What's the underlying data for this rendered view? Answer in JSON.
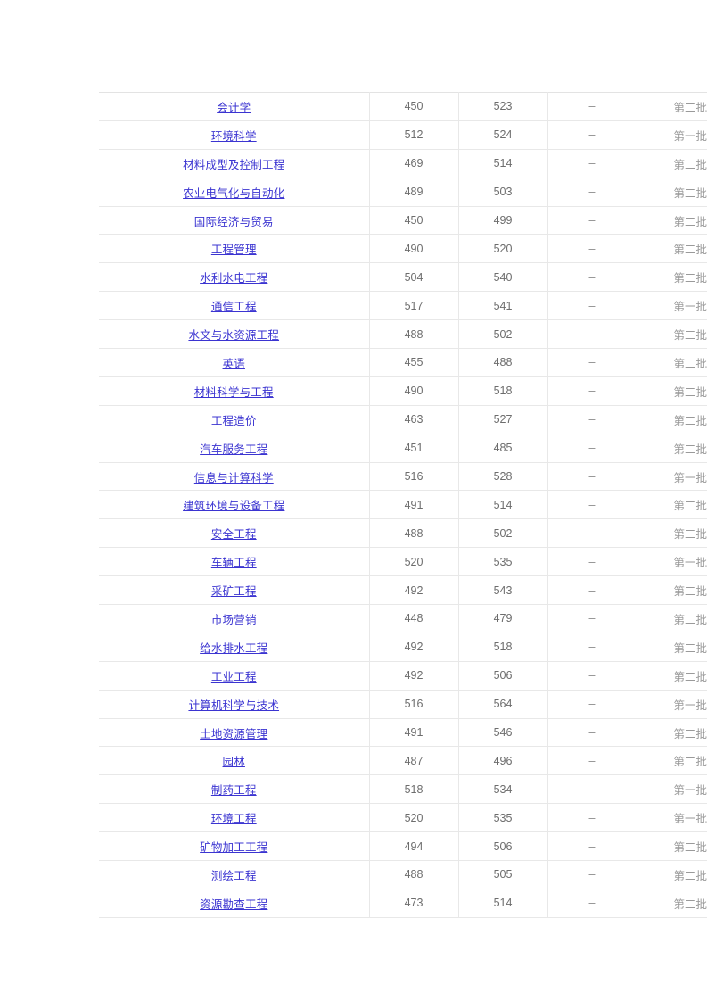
{
  "table": {
    "columns": [
      {
        "key": "major",
        "name": "major-name"
      },
      {
        "key": "min",
        "name": "min-score"
      },
      {
        "key": "avg",
        "name": "avg-score"
      },
      {
        "key": "rank",
        "name": "rank-value"
      },
      {
        "key": "batch",
        "name": "admission-batch"
      }
    ],
    "link_color": "#3b34d1",
    "major_cell_bg": "#f1f1f1",
    "grid_color": "#e8e8e8",
    "rows": [
      {
        "major": "会计学",
        "min": "450",
        "avg": "523",
        "rank": "–",
        "batch": "第二批"
      },
      {
        "major": "环境科学",
        "min": "512",
        "avg": "524",
        "rank": "–",
        "batch": "第一批"
      },
      {
        "major": "材料成型及控制工程",
        "min": "469",
        "avg": "514",
        "rank": "–",
        "batch": "第二批"
      },
      {
        "major": "农业电气化与自动化",
        "min": "489",
        "avg": "503",
        "rank": "–",
        "batch": "第二批"
      },
      {
        "major": "国际经济与贸易",
        "min": "450",
        "avg": "499",
        "rank": "–",
        "batch": "第二批"
      },
      {
        "major": "工程管理",
        "min": "490",
        "avg": "520",
        "rank": "–",
        "batch": "第二批"
      },
      {
        "major": "水利水电工程",
        "min": "504",
        "avg": "540",
        "rank": "–",
        "batch": "第二批"
      },
      {
        "major": "通信工程",
        "min": "517",
        "avg": "541",
        "rank": "–",
        "batch": "第一批"
      },
      {
        "major": "水文与水资源工程",
        "min": "488",
        "avg": "502",
        "rank": "–",
        "batch": "第二批"
      },
      {
        "major": "英语",
        "min": "455",
        "avg": "488",
        "rank": "–",
        "batch": "第二批"
      },
      {
        "major": "材料科学与工程",
        "min": "490",
        "avg": "518",
        "rank": "–",
        "batch": "第二批"
      },
      {
        "major": "工程造价",
        "min": "463",
        "avg": "527",
        "rank": "–",
        "batch": "第二批"
      },
      {
        "major": "汽车服务工程",
        "min": "451",
        "avg": "485",
        "rank": "–",
        "batch": "第二批"
      },
      {
        "major": "信息与计算科学",
        "min": "516",
        "avg": "528",
        "rank": "–",
        "batch": "第一批"
      },
      {
        "major": "建筑环境与设备工程",
        "min": "491",
        "avg": "514",
        "rank": "–",
        "batch": "第二批"
      },
      {
        "major": "安全工程",
        "min": "488",
        "avg": "502",
        "rank": "–",
        "batch": "第二批"
      },
      {
        "major": "车辆工程",
        "min": "520",
        "avg": "535",
        "rank": "–",
        "batch": "第一批"
      },
      {
        "major": "采矿工程",
        "min": "492",
        "avg": "543",
        "rank": "–",
        "batch": "第二批"
      },
      {
        "major": "市场营销",
        "min": "448",
        "avg": "479",
        "rank": "–",
        "batch": "第二批"
      },
      {
        "major": "给水排水工程",
        "min": "492",
        "avg": "518",
        "rank": "–",
        "batch": "第二批"
      },
      {
        "major": "工业工程",
        "min": "492",
        "avg": "506",
        "rank": "–",
        "batch": "第二批"
      },
      {
        "major": "计算机科学与技术",
        "min": "516",
        "avg": "564",
        "rank": "–",
        "batch": "第一批"
      },
      {
        "major": "土地资源管理",
        "min": "491",
        "avg": "546",
        "rank": "–",
        "batch": "第二批"
      },
      {
        "major": "园林",
        "min": "487",
        "avg": "496",
        "rank": "–",
        "batch": "第二批"
      },
      {
        "major": "制药工程",
        "min": "518",
        "avg": "534",
        "rank": "–",
        "batch": "第一批"
      },
      {
        "major": "环境工程",
        "min": "520",
        "avg": "535",
        "rank": "–",
        "batch": "第一批"
      },
      {
        "major": "矿物加工工程",
        "min": "494",
        "avg": "506",
        "rank": "–",
        "batch": "第二批"
      },
      {
        "major": "测绘工程",
        "min": "488",
        "avg": "505",
        "rank": "–",
        "batch": "第二批"
      },
      {
        "major": "资源勘查工程",
        "min": "473",
        "avg": "514",
        "rank": "–",
        "batch": "第二批"
      }
    ]
  }
}
